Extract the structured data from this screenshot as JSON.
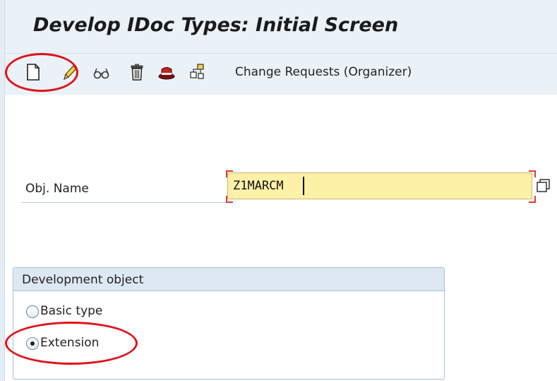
{
  "window": {
    "title": "Develop IDoc Types: Initial Screen"
  },
  "toolbar": {
    "icons": [
      "create-icon",
      "change-icon",
      "display-icon",
      "delete-icon",
      "copy-icon",
      "rename-icon"
    ],
    "change_requests_label": "Change Requests (Organizer)"
  },
  "form": {
    "obj_name_label": "Obj. Name",
    "obj_name_value": "Z1MARCM"
  },
  "development_object": {
    "title": "Development object",
    "options": [
      {
        "label": "Basic type",
        "selected": false
      },
      {
        "label": "Extension",
        "selected": true
      }
    ]
  },
  "colors": {
    "highlight": "#e0121b",
    "input_background": "#fdf1a8",
    "title_bar": "#eaf2f8"
  }
}
